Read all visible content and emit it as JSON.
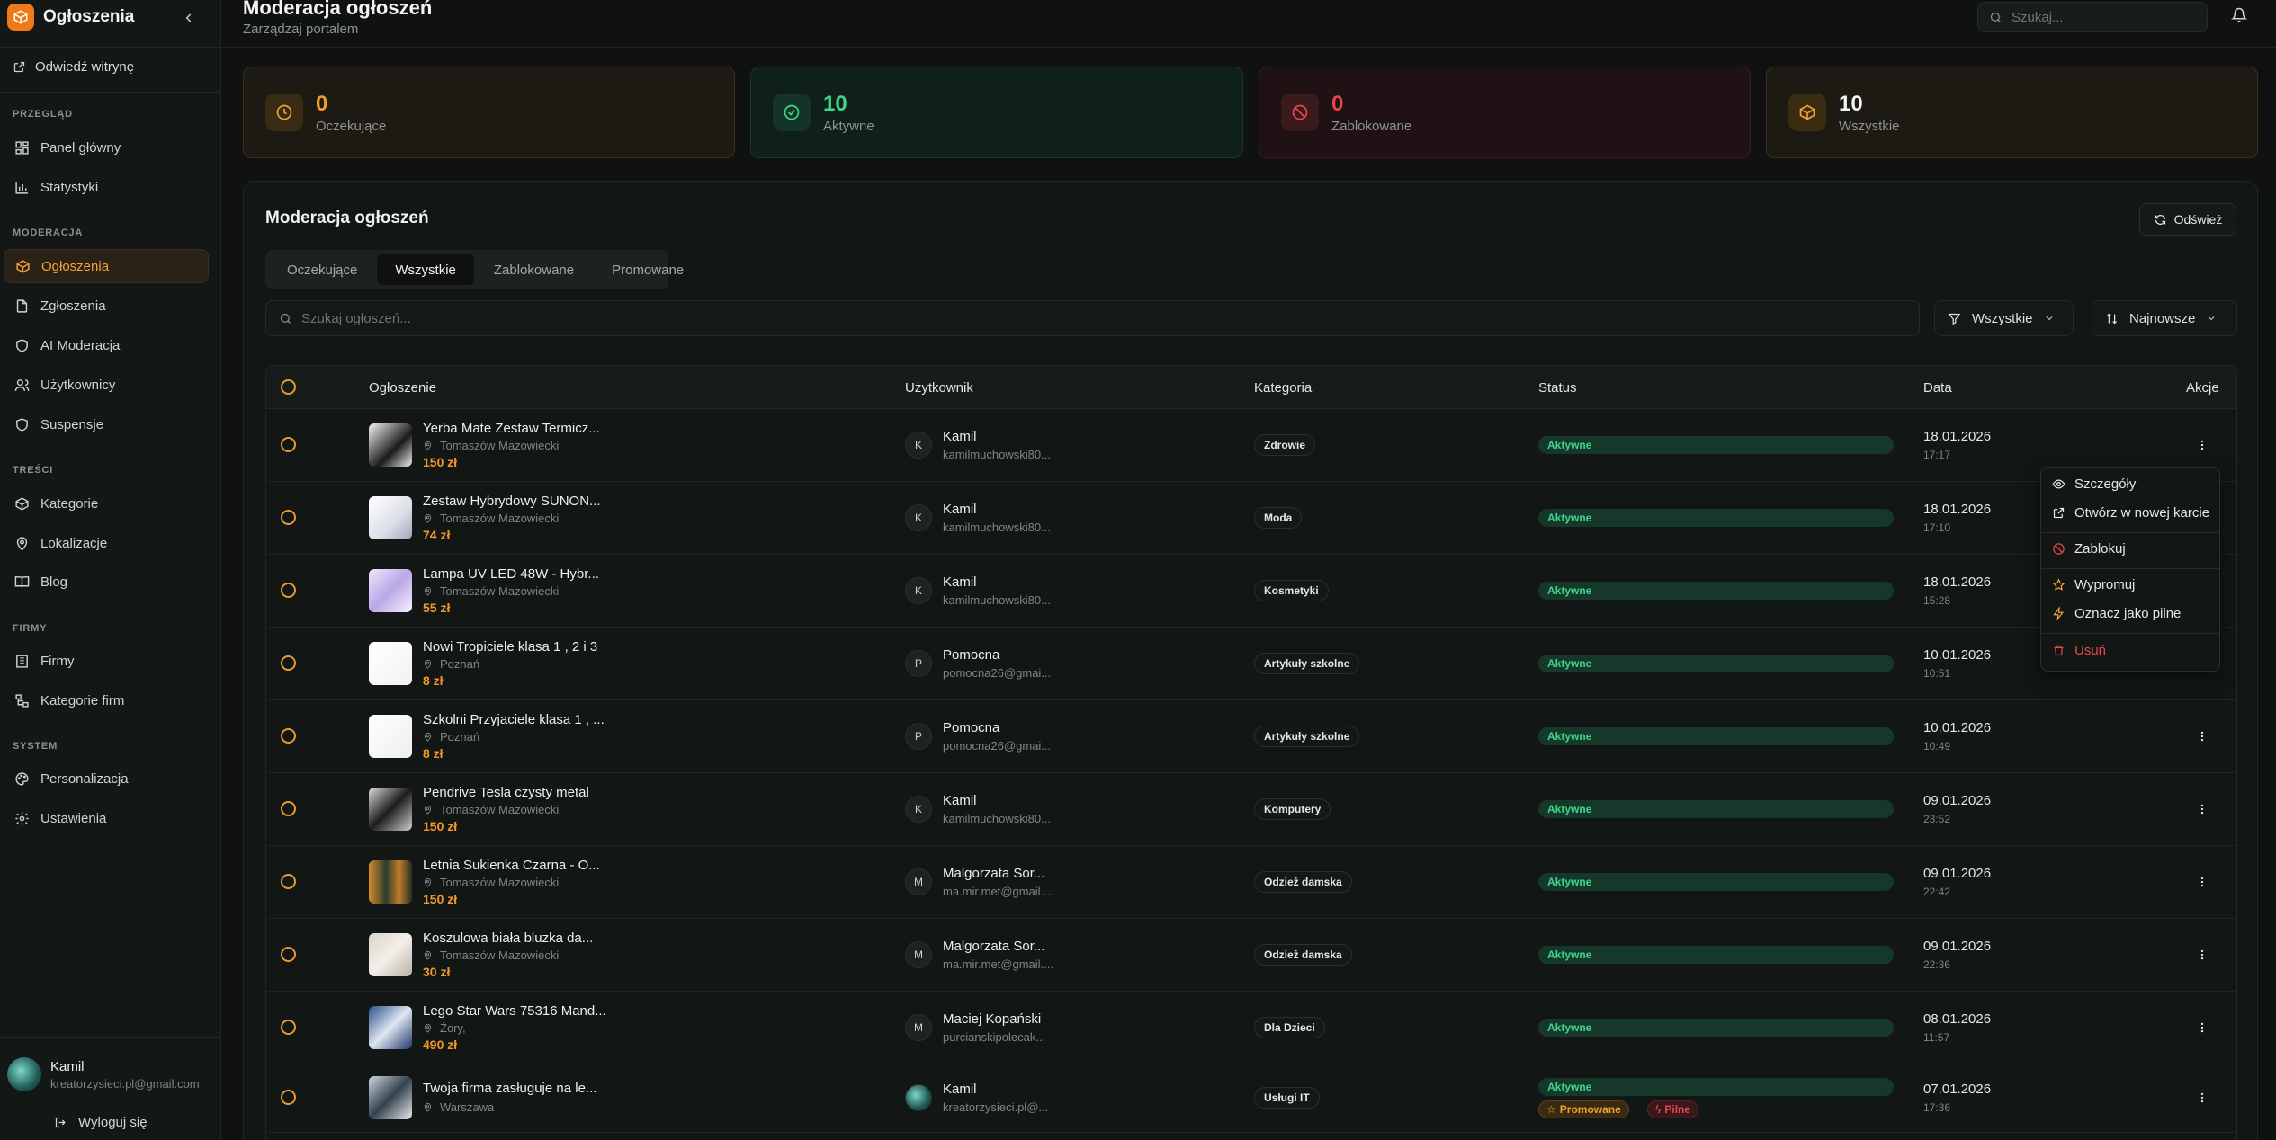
{
  "sidebar": {
    "brand": "Ogłoszenia",
    "visit_site": "Odwiedź witrynę",
    "sections": {
      "overview": "PRZEGLĄD",
      "moderation": "MODERACJA",
      "content": "TREŚCI",
      "companies": "FIRMY",
      "system": "SYSTEM"
    },
    "items": {
      "dashboard": "Panel główny",
      "stats": "Statystyki",
      "ads": "Ogłoszenia",
      "reports": "Zgłoszenia",
      "ai": "AI Moderacja",
      "users": "Użytkownicy",
      "suspensions": "Suspensje",
      "categories": "Kategorie",
      "locations": "Lokalizacje",
      "blog": "Blog",
      "companies": "Firmy",
      "company_categories": "Kategorie firm",
      "personalization": "Personalizacja",
      "settings": "Ustawienia"
    },
    "user": {
      "name": "Kamil",
      "email": "kreatorzysieci.pl@gmail.com"
    },
    "logout": "Wyloguj się"
  },
  "header": {
    "title": "Moderacja ogłoszeń",
    "subtitle": "Zarządzaj portalem",
    "search_placeholder": "Szukaj..."
  },
  "stats": [
    {
      "value": "0",
      "label": "Oczekujące"
    },
    {
      "value": "10",
      "label": "Aktywne"
    },
    {
      "value": "0",
      "label": "Zablokowane"
    },
    {
      "value": "10",
      "label": "Wszystkie"
    }
  ],
  "panel": {
    "title": "Moderacja ogłoszeń",
    "refresh": "Odśwież",
    "tabs": [
      "Oczekujące",
      "Wszystkie",
      "Zablokowane",
      "Promowane"
    ],
    "active_tab": "Wszystkie",
    "search_placeholder": "Szukaj ogłoszeń...",
    "filter": "Wszystkie",
    "sort": "Najnowsze"
  },
  "table": {
    "columns": [
      "Ogłoszenie",
      "Użytkownik",
      "Kategoria",
      "Status",
      "Data",
      "Akcje"
    ],
    "rows": [
      {
        "title": "Yerba Mate Zestaw Termicz...",
        "location": "Tomaszów Mazowiecki",
        "price": "150 zł",
        "user_initial": "K",
        "user": "Kamil",
        "email": "kamilmuchowski80...",
        "category": "Zdrowie",
        "status": "Aktywne",
        "date": "18.01.2026",
        "time": "17:17"
      },
      {
        "title": "Zestaw Hybrydowy SUNON...",
        "location": "Tomaszów Mazowiecki",
        "price": "74 zł",
        "user_initial": "K",
        "user": "Kamil",
        "email": "kamilmuchowski80...",
        "category": "Moda",
        "status": "Aktywne",
        "date": "18.01.2026",
        "time": "17:10"
      },
      {
        "title": "Lampa UV LED 48W - Hybr...",
        "location": "Tomaszów Mazowiecki",
        "price": "55 zł",
        "user_initial": "K",
        "user": "Kamil",
        "email": "kamilmuchowski80...",
        "category": "Kosmetyki",
        "status": "Aktywne",
        "date": "18.01.2026",
        "time": "15:28"
      },
      {
        "title": "Nowi Tropiciele klasa 1 , 2 i 3",
        "location": "Poznań",
        "price": "8 zł",
        "user_initial": "P",
        "user": "Pomocna",
        "email": "pomocna26@gmai...",
        "category": "Artykuły szkolne",
        "status": "Aktywne",
        "date": "10.01.2026",
        "time": "10:51"
      },
      {
        "title": "Szkolni Przyjaciele klasa 1 , ...",
        "location": "Poznań",
        "price": "8 zł",
        "user_initial": "P",
        "user": "Pomocna",
        "email": "pomocna26@gmai...",
        "category": "Artykuły szkolne",
        "status": "Aktywne",
        "date": "10.01.2026",
        "time": "10:49"
      },
      {
        "title": "Pendrive Tesla czysty metal",
        "location": "Tomaszów Mazowiecki",
        "price": "150 zł",
        "user_initial": "K",
        "user": "Kamil",
        "email": "kamilmuchowski80...",
        "category": "Komputery",
        "status": "Aktywne",
        "date": "09.01.2026",
        "time": "23:52"
      },
      {
        "title": "Letnia Sukienka Czarna - O...",
        "location": "Tomaszów Mazowiecki",
        "price": "150 zł",
        "user_initial": "M",
        "user": "Malgorzata Sor...",
        "email": "ma.mir.met@gmail....",
        "category": "Odzież damska",
        "status": "Aktywne",
        "date": "09.01.2026",
        "time": "22:42"
      },
      {
        "title": "Koszulowa biała bluzka da...",
        "location": "Tomaszów Mazowiecki",
        "price": "30 zł",
        "user_initial": "M",
        "user": "Malgorzata Sor...",
        "email": "ma.mir.met@gmail....",
        "category": "Odzież damska",
        "status": "Aktywne",
        "date": "09.01.2026",
        "time": "22:36"
      },
      {
        "title": "Lego Star Wars 75316 Mand...",
        "location": "Żory,",
        "price": "490 zł",
        "user_initial": "M",
        "user": "Maciej Kopański",
        "email": "purcianskipolecak...",
        "category": "Dla Dzieci",
        "status": "Aktywne",
        "date": "08.01.2026",
        "time": "11:57"
      },
      {
        "title": "Twoja firma zasługuje na le...",
        "location": "Warszawa",
        "price": "",
        "user_initial": "",
        "user": "Kamil",
        "email": "kreatorzysieci.pl@...",
        "category": "Usługi IT",
        "status": "Aktywne",
        "badge_promo": "Promowane",
        "badge_urgent": "Pilne",
        "date": "07.01.2026",
        "time": "17:36"
      }
    ]
  },
  "menu": {
    "details": "Szczegóły",
    "open_new_tab": "Otwórz w nowej karcie",
    "block": "Zablokuj",
    "promote": "Wypromuj",
    "mark_urgent": "Oznacz jako pilne",
    "delete": "Usuń"
  },
  "colors": {
    "accent": "#f39a2a",
    "active_green": "#3ed58a",
    "danger": "#e5484d",
    "background": "#0f1211"
  }
}
